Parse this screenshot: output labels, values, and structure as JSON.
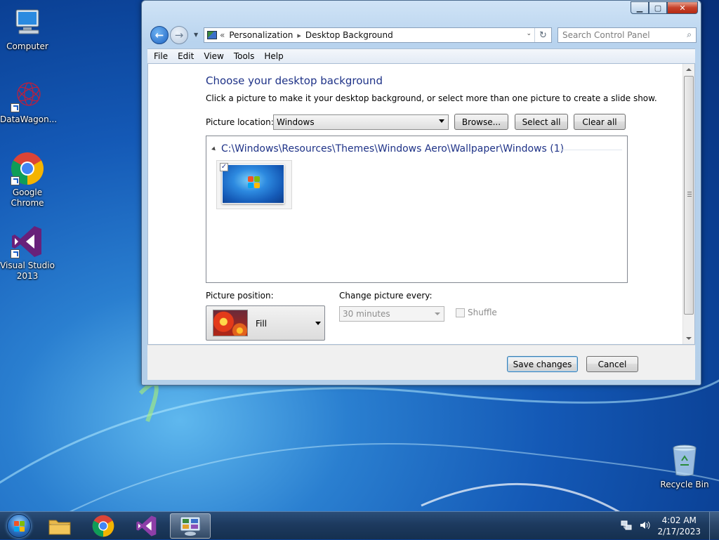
{
  "desktop": {
    "icons": [
      {
        "label": "Computer"
      },
      {
        "label": "DataWagon..."
      },
      {
        "label": "Google Chrome"
      },
      {
        "label": "Visual Studio 2013"
      },
      {
        "label": "Recycle Bin"
      }
    ]
  },
  "window": {
    "breadcrumb": {
      "chevron": "«",
      "part1": "Personalization",
      "sep": "▸",
      "part2": "Desktop Background"
    },
    "search_placeholder": "Search Control Panel",
    "menu": [
      "File",
      "Edit",
      "View",
      "Tools",
      "Help"
    ],
    "heading": "Choose your desktop background",
    "subtitle": "Click a picture to make it your desktop background, or select more than one picture to create a slide show.",
    "picture_location_label": "Picture location:",
    "picture_location_value": "Windows",
    "buttons": {
      "browse": "Browse...",
      "select_all": "Select all",
      "clear_all": "Clear all",
      "save": "Save changes",
      "cancel": "Cancel"
    },
    "gallery": {
      "group_header": "C:\\Windows\\Resources\\Themes\\Windows Aero\\Wallpaper\\Windows (1)",
      "thumb_checked": "✓"
    },
    "picture_position_label": "Picture position:",
    "picture_position_value": "Fill",
    "change_every_label": "Change picture every:",
    "change_every_value": "30 minutes",
    "shuffle_label": "Shuffle"
  },
  "taskbar": {
    "time": "4:02 AM",
    "date": "2/17/2023"
  },
  "colors": {
    "heading": "#1e3287",
    "desktop": "#1459b6",
    "taskbar": "#1d3a5f"
  }
}
